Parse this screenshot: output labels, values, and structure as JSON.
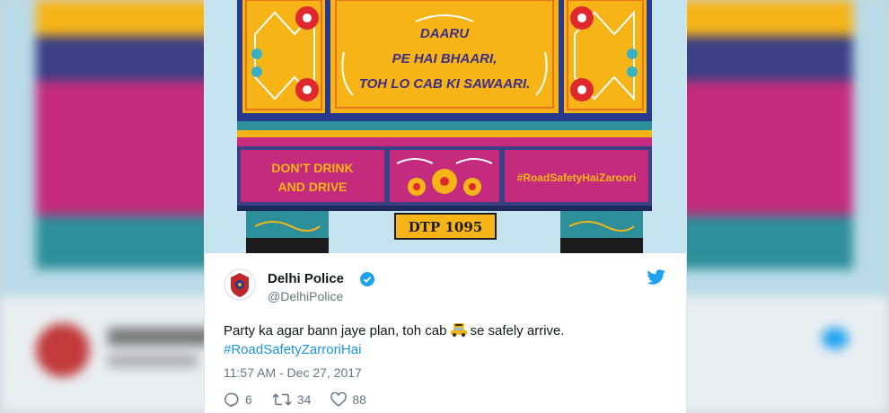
{
  "artwork": {
    "slogan": [
      "DAARU",
      "PE HAI BHAARI,",
      "TOH LO CAB KI SAWAARI."
    ],
    "left_panel": [
      "DON'T DRINK",
      "AND DRIVE"
    ],
    "right_panel": "#RoadSafetyHaiZaroori",
    "plate": "DTP 1095"
  },
  "tweet": {
    "name": "Delhi Police",
    "handle": "@DelhiPolice",
    "text_before": "Party ka agar bann jaye plan, toh cab",
    "text_after": "se safely arrive.",
    "hashtag": "#RoadSafetyZarroriHai",
    "timestamp": "11:57 AM - Dec 27, 2017",
    "replies": "6",
    "retweets": "34",
    "likes": "88"
  },
  "colors": {
    "truck_yellow": "#f6b417",
    "truck_magenta": "#c42b7c",
    "twitter_blue": "#1da1f2",
    "link_blue": "#1b95e0",
    "text_dark": "#14171a",
    "text_gray": "#657786"
  },
  "icons": [
    "police-badge-icon",
    "verified-badge-icon",
    "twitter-bird-icon",
    "taxi-emoji-icon",
    "reply-icon",
    "retweet-icon",
    "like-icon"
  ]
}
